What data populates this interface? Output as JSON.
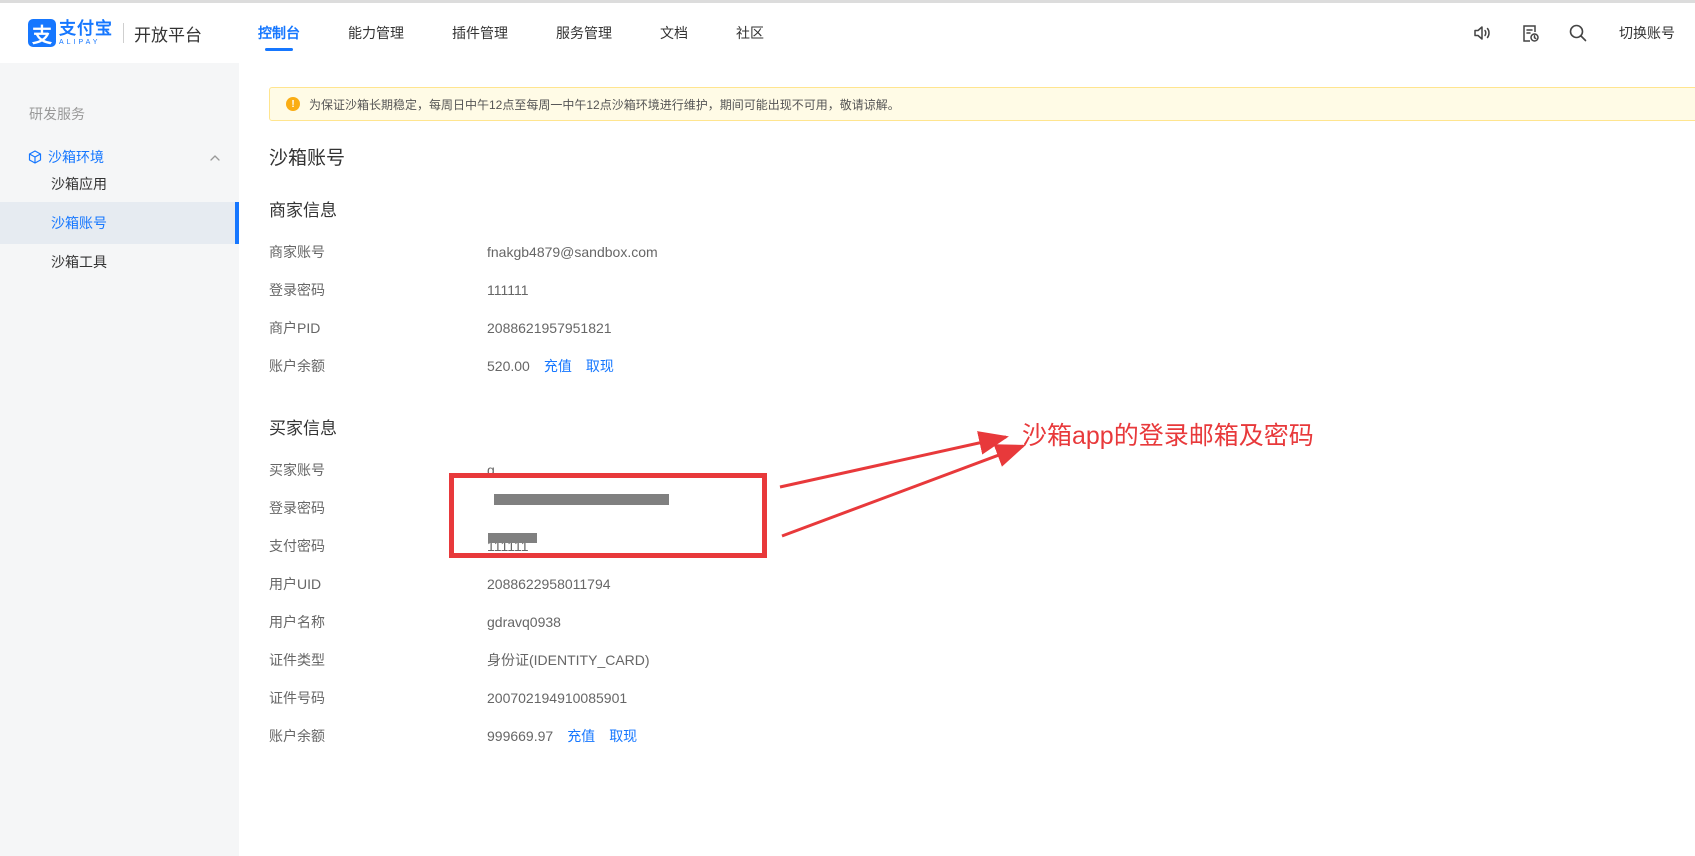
{
  "header": {
    "logo_cn": "支付宝",
    "logo_en": "ALIPAY",
    "platform": "开放平台",
    "nav": [
      {
        "label": "控制台",
        "active": true
      },
      {
        "label": "能力管理",
        "active": false
      },
      {
        "label": "插件管理",
        "active": false
      },
      {
        "label": "服务管理",
        "active": false
      },
      {
        "label": "文档",
        "active": false
      },
      {
        "label": "社区",
        "active": false
      }
    ],
    "icons": [
      "speaker-icon",
      "document-icon",
      "search-icon"
    ],
    "switch_account": "切换账号"
  },
  "sidebar": {
    "group_label": "研发服务",
    "parent": {
      "label": "沙箱环境",
      "icon": "cube-icon"
    },
    "children": [
      {
        "label": "沙箱应用",
        "active": false
      },
      {
        "label": "沙箱账号",
        "active": true
      },
      {
        "label": "沙箱工具",
        "active": false
      }
    ]
  },
  "notice": "为保证沙箱长期稳定，每周日中午12点至每周一中午12点沙箱环境进行维护，期间可能出现不可用，敬请谅解。",
  "page_title": "沙箱账号",
  "merchant": {
    "title": "商家信息",
    "rows": [
      {
        "label": "商家账号",
        "value": "fnakgb4879@sandbox.com"
      },
      {
        "label": "登录密码",
        "value": "111111"
      },
      {
        "label": "商户PID",
        "value": "2088621957951821"
      },
      {
        "label": "账户余额",
        "value": "520.00",
        "links": [
          "充值",
          "取现"
        ]
      }
    ]
  },
  "buyer": {
    "title": "买家信息",
    "rows": [
      {
        "label": "买家账号",
        "value": "g"
      },
      {
        "label": "登录密码",
        "value": ""
      },
      {
        "label": "支付密码",
        "value": "111111"
      },
      {
        "label": "用户UID",
        "value": "2088622958011794"
      },
      {
        "label": "用户名称",
        "value": "gdravq0938"
      },
      {
        "label": "证件类型",
        "value": "身份证(IDENTITY_CARD)"
      },
      {
        "label": "证件号码",
        "value": "200702194910085901"
      },
      {
        "label": "账户余额",
        "value": "999669.97",
        "links": [
          "充值",
          "取现"
        ]
      }
    ]
  },
  "annotation": "沙箱app的登录邮箱及密码",
  "colors": {
    "accent": "#1677ff",
    "annotation_red": "#e8393b",
    "notice_bg": "#fffbe6"
  }
}
